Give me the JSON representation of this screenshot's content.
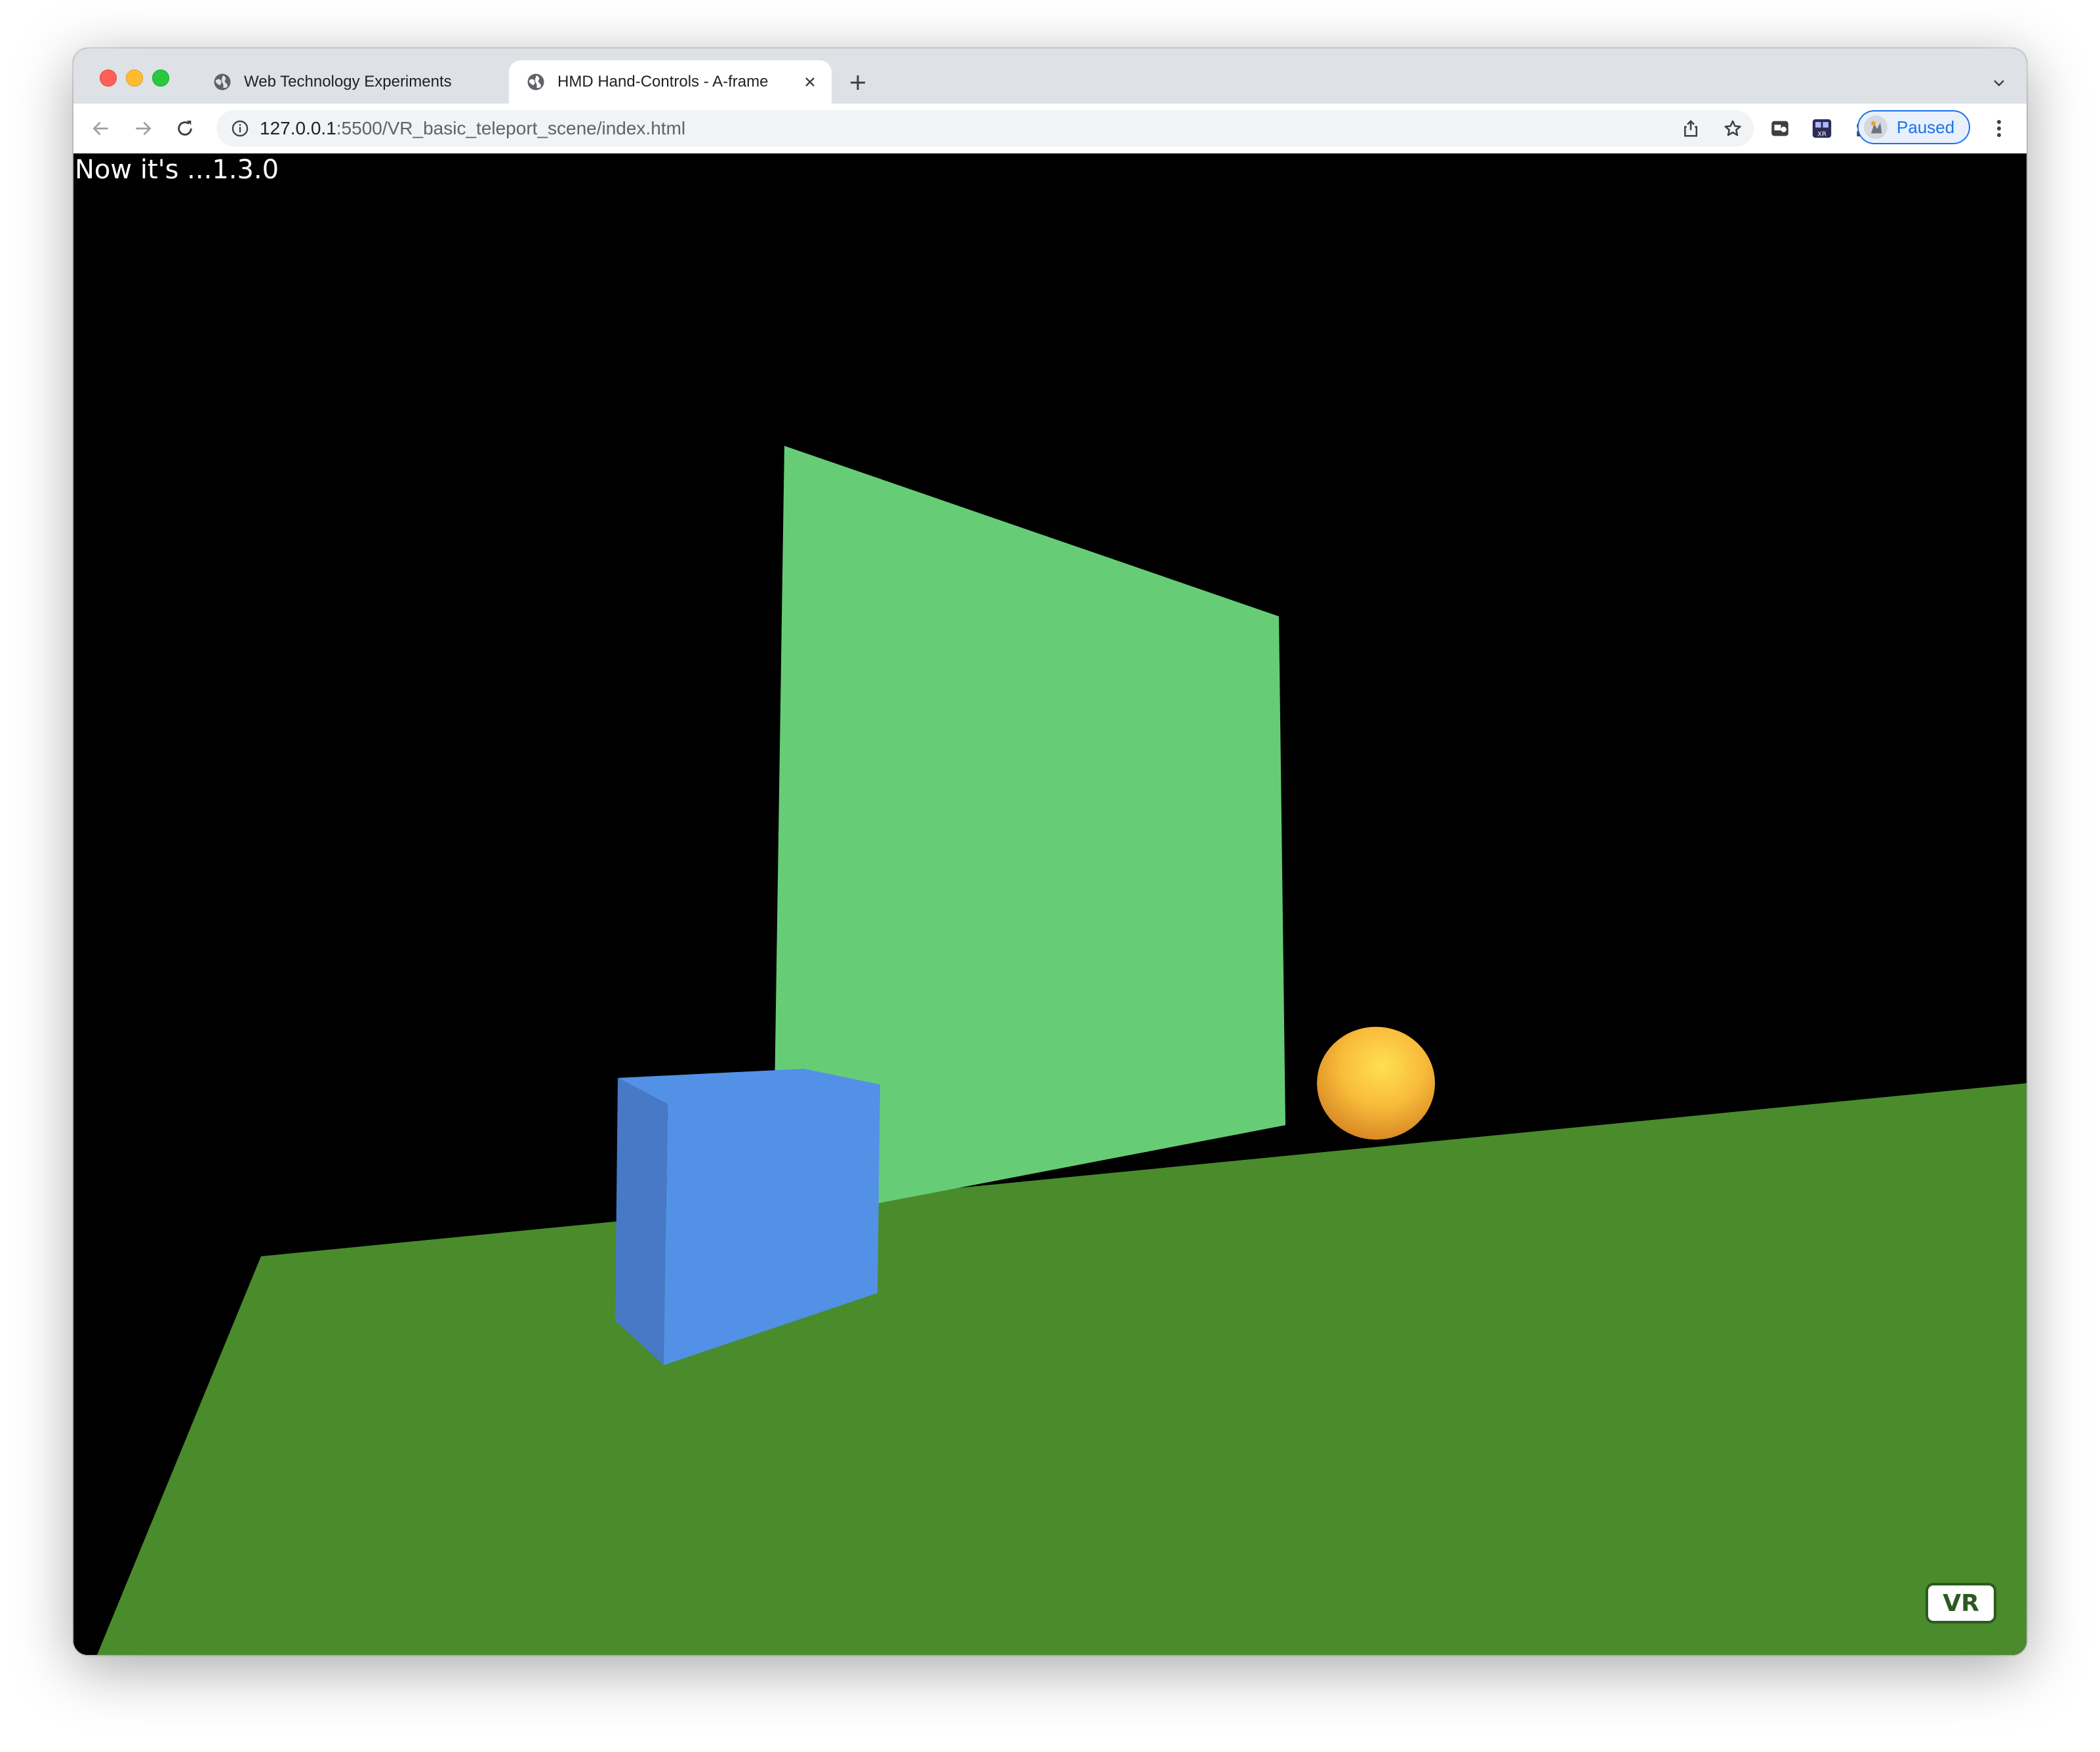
{
  "browser": {
    "tabs": [
      {
        "title": "Web Technology Experiments",
        "icon": "globe-icon",
        "active": false
      },
      {
        "title": "HMD Hand-Controls - A-frame",
        "icon": "globe-icon",
        "active": true
      }
    ],
    "address_bar": {
      "host": "127.0.0.1",
      "path": ":5500/VR_basic_teleport_scene/index.html"
    },
    "profile": {
      "label": "Paused"
    }
  },
  "page": {
    "overlay_text": "Now it's ...1.3.0",
    "vr_button_label": "VR"
  },
  "scene": {
    "background": "#000000",
    "ground_color": "#4a8b2c",
    "wall_color": "#66cd76",
    "box_color": "#5291e6",
    "sphere_color": "#f8bb3a"
  }
}
